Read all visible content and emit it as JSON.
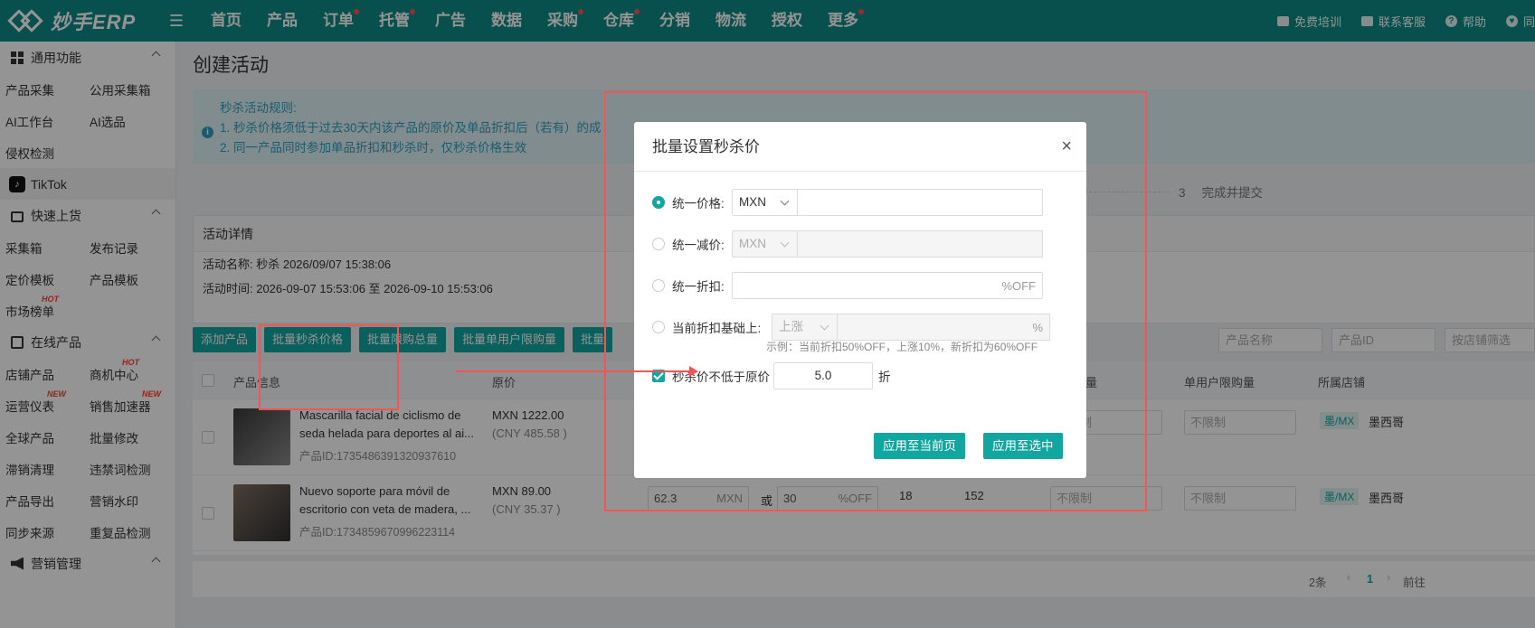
{
  "app": {
    "logo_text": "妙手ERP"
  },
  "nav": {
    "items": [
      {
        "label": "首页",
        "dot": false
      },
      {
        "label": "产品",
        "dot": false
      },
      {
        "label": "订单",
        "dot": true
      },
      {
        "label": "托管",
        "dot": true
      },
      {
        "label": "广告",
        "dot": false
      },
      {
        "label": "数据",
        "dot": false
      },
      {
        "label": "采购",
        "dot": true
      },
      {
        "label": "仓库",
        "dot": true
      },
      {
        "label": "分销",
        "dot": false
      },
      {
        "label": "物流",
        "dot": false
      },
      {
        "label": "授权",
        "dot": false
      },
      {
        "label": "更多",
        "dot": true
      }
    ],
    "right": [
      "免费培训",
      "联系客服",
      "帮助",
      "同"
    ]
  },
  "sidebar": {
    "common": "通用功能",
    "common_links": [
      [
        "产品采集",
        "公用采集箱"
      ],
      [
        "AI工作台",
        "AI选品"
      ],
      [
        "侵权检测",
        ""
      ]
    ],
    "tiktok": "TikTok",
    "quick": "快速上货",
    "quick_links": [
      [
        "采集箱",
        "发布记录"
      ],
      [
        "定价模板",
        "产品模板"
      ],
      [
        "市场榜单",
        ""
      ]
    ],
    "quick_badge": "HOT",
    "online": "在线产品",
    "online_links": [
      [
        "店铺产品",
        "商机中心"
      ],
      [
        "运营仪表",
        "销售加速器"
      ],
      [
        "全球产品",
        "批量修改"
      ],
      [
        "滞销清理",
        "违禁词检测"
      ],
      [
        "产品导出",
        "营销水印"
      ],
      [
        "同步来源",
        "重复品检测"
      ]
    ],
    "badges": {
      "hot": "HOT",
      "new": "NEW"
    },
    "marketing": "营销管理"
  },
  "main": {
    "title": "创建活动",
    "rules_title": "秒杀活动规则:",
    "rule1": "1. 秒杀价格须低于过去30天内该产品的原价及单品折扣后（若有）的成",
    "rule2": "2. 同一产品同时参加单品折扣和秒杀时，仅秒杀价格生效",
    "step3_num": "3",
    "step3_label": "完成并提交",
    "detail_title": "活动详情",
    "detail_name": "活动名称:  秒杀 2026/09/07 15:38:06",
    "detail_time": "活动时间:  2026-09-07 15:53:06 至 2026-09-10 15:53:06",
    "buttons": [
      "添加产品",
      "批量秒杀价格",
      "批量限购总量",
      "批量单用户限购量",
      "批量"
    ],
    "filters": [
      "产品名称",
      "产品ID",
      "按店铺筛选"
    ],
    "columns": {
      "info": "产品信息",
      "price": "原价",
      "limit_total": "限购总量",
      "limit_user": "单用户限购量",
      "shop": "所属店铺"
    },
    "rows": [
      {
        "name": "Mascarilla facial de ciclismo de seda helada para deportes al ai...",
        "id": "产品ID:1735486391320937610",
        "price": "MXN 1222.00",
        "cny": "(CNY 485.58 )",
        "limit_total": "不限制",
        "limit_user": "不限制",
        "shop_tag": "墨/MX",
        "shop": "墨西哥"
      },
      {
        "name": "Nuevo soporte para móvil de escritorio con veta de madera, ...",
        "id": "产品ID:1734859670996223114",
        "price": "MXN 89.00",
        "cny": "(CNY 35.37 )",
        "flash_price": "62.3",
        "flash_unit": "MXN",
        "or": "或",
        "discount": "30",
        "discount_unit": "%OFF",
        "stock": "18",
        "qty": "152",
        "limit_total": "不限制",
        "limit_user": "不限制",
        "shop_tag": "墨/MX",
        "shop": "墨西哥"
      }
    ],
    "pager": {
      "total": "2条",
      "page": "1",
      "goto": "前往"
    }
  },
  "modal": {
    "title": "批量设置秒杀价",
    "opt1": "统一价格:",
    "opt1_currency": "MXN",
    "opt2": "统一减价:",
    "opt2_currency": "MXN",
    "opt3": "统一折扣:",
    "opt3_suffix": "%OFF",
    "opt4": "当前折扣基础上:",
    "opt4_select": "上涨",
    "opt4_suffix": "%",
    "hint": "示例：当前折扣50%OFF，上涨10%，新折扣为60%OFF",
    "min_label": "秒杀价不低于原价",
    "min_value": "5.0",
    "min_unit": "折",
    "btn_page": "应用至当前页",
    "btn_selected": "应用至选中"
  }
}
